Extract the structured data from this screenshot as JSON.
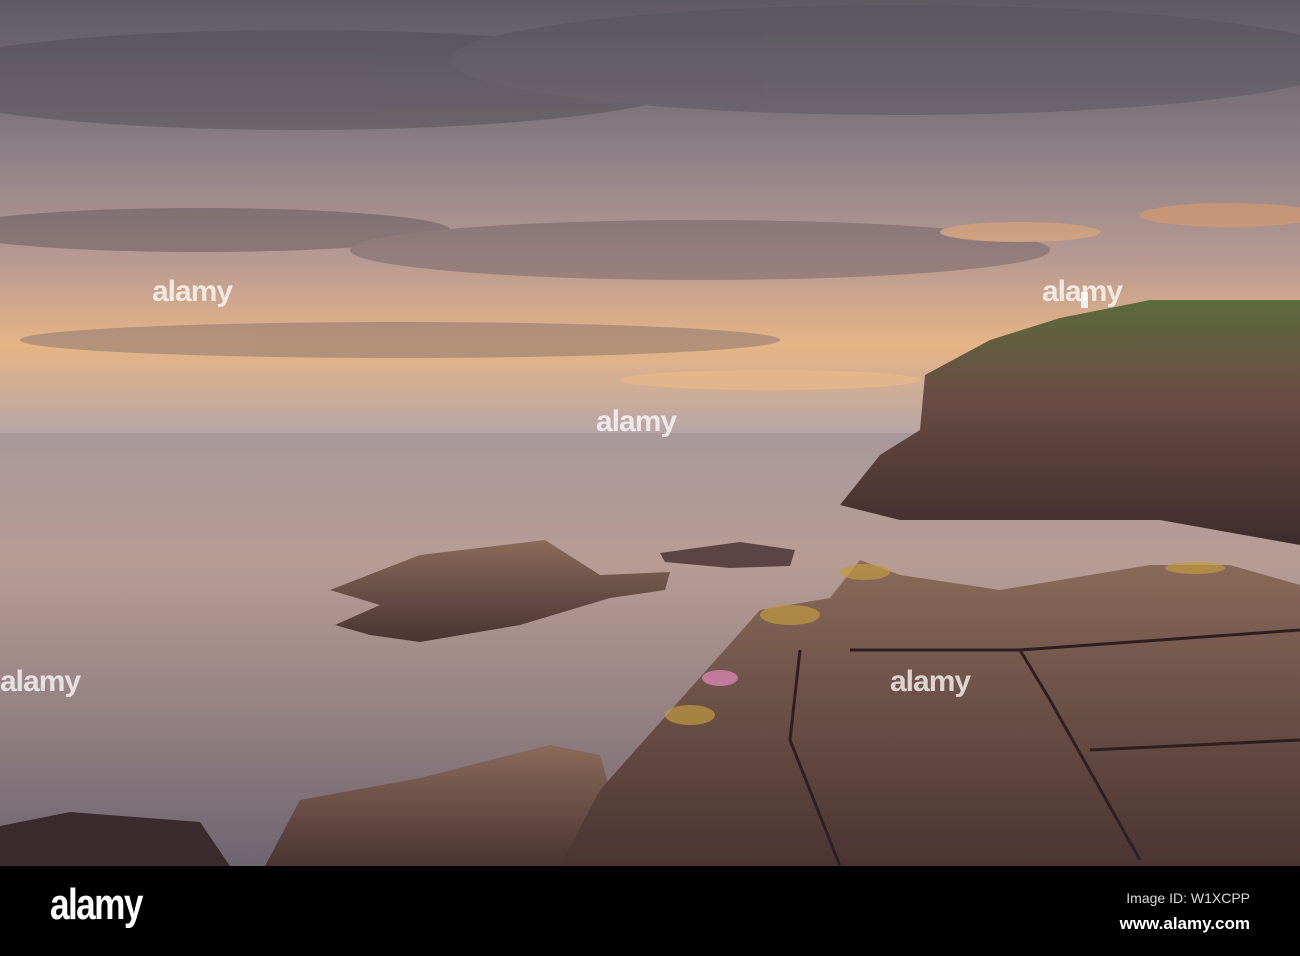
{
  "watermark": {
    "brand": "alamy"
  },
  "footer": {
    "logo": "alamy",
    "image_id": "Image ID: W1XCPP",
    "website": "www.alamy.com"
  },
  "colors": {
    "sky_top": "#6e6a70",
    "sunset": "#f0b478",
    "sea": "#8a7c80",
    "rock": "#6a4a44",
    "footer": "#000000"
  }
}
